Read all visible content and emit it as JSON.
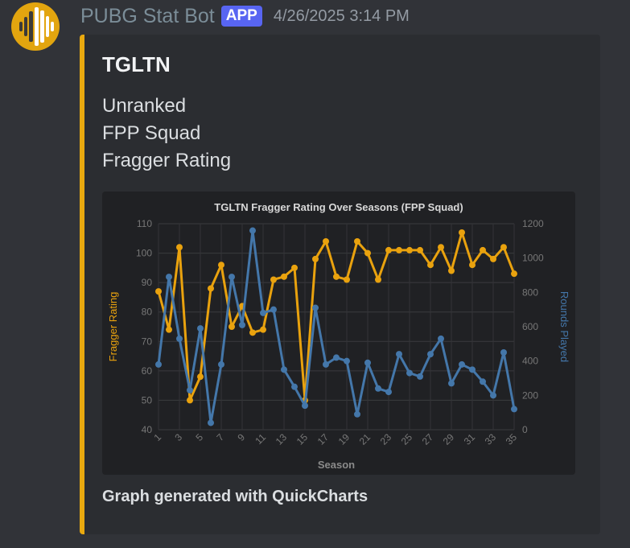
{
  "message": {
    "username": "PUBG Stat Bot",
    "badge": "APP",
    "timestamp": "4/26/2025 3:14 PM",
    "avatar_icon": "soundwave-icon",
    "avatar_color": "#e2a50f"
  },
  "embed": {
    "accent_color": "#e9a90f",
    "title": "TGLTN",
    "lines": [
      "Unranked",
      "FPP Squad",
      "Fragger Rating"
    ],
    "footer": "Graph generated with QuickCharts"
  },
  "chart_data": {
    "type": "line",
    "title": "TGLTN Fragger Rating Over Seasons (FPP Squad)",
    "xlabel": "Season",
    "ylabel_left": "Fragger Rating",
    "ylabel_right": "Rounds Played",
    "x": [
      1,
      2,
      3,
      4,
      5,
      6,
      7,
      8,
      9,
      10,
      11,
      12,
      13,
      14,
      15,
      16,
      17,
      18,
      19,
      20,
      21,
      22,
      23,
      24,
      25,
      26,
      27,
      28,
      29,
      30,
      31,
      32,
      33,
      34,
      35
    ],
    "x_tick_labels": [
      "1",
      "3",
      "5",
      "7",
      "9",
      "11",
      "13",
      "15",
      "17",
      "19",
      "21",
      "23",
      "25",
      "27",
      "29",
      "31",
      "33",
      "35"
    ],
    "y_left_ticks": [
      "40",
      "50",
      "60",
      "70",
      "80",
      "90",
      "100",
      "110"
    ],
    "y_right_ticks": [
      "0",
      "200",
      "400",
      "600",
      "800",
      "1000",
      "1200"
    ],
    "ylim_left": [
      40,
      110
    ],
    "ylim_right": [
      0,
      1200
    ],
    "grid": true,
    "series": [
      {
        "name": "Fragger Rating",
        "axis": "left",
        "color": "#e9a20e",
        "values": [
          87,
          74,
          102,
          50,
          58,
          88,
          96,
          75,
          82,
          73,
          74,
          91,
          92,
          95,
          50,
          98,
          104,
          92,
          91,
          104,
          100,
          91,
          101,
          101,
          101,
          101,
          96,
          102,
          94,
          107,
          96,
          101,
          98,
          102,
          93
        ]
      },
      {
        "name": "Rounds Played",
        "axis": "right",
        "color": "#4477aa",
        "values": [
          380,
          890,
          530,
          230,
          590,
          40,
          380,
          890,
          610,
          1160,
          680,
          700,
          350,
          250,
          140,
          710,
          380,
          420,
          400,
          90,
          390,
          240,
          220,
          440,
          330,
          310,
          440,
          530,
          270,
          380,
          350,
          280,
          200,
          450,
          120
        ]
      }
    ]
  }
}
